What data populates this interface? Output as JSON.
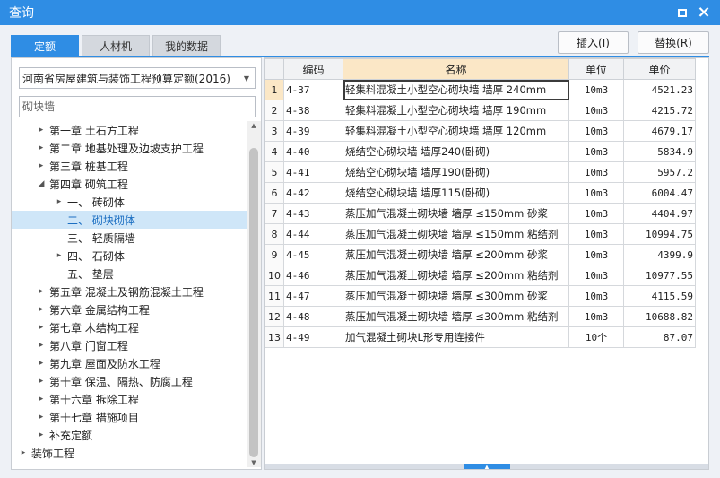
{
  "window": {
    "title": "查询"
  },
  "tabs": [
    {
      "label": "定额",
      "active": true
    },
    {
      "label": "人材机",
      "active": false
    },
    {
      "label": "我的数据",
      "active": false
    }
  ],
  "toolbar": {
    "insert_label": "插入(I)",
    "replace_label": "替换(R)"
  },
  "left": {
    "library": "河南省房屋建筑与装饰工程预算定额(2016)",
    "search_value": "",
    "search_placeholder": "砌块墙",
    "tree": [
      {
        "label": "第一章 土石方工程",
        "level": 1,
        "toggle": "▸",
        "selected": false
      },
      {
        "label": "第二章 地基处理及边坡支护工程",
        "level": 1,
        "toggle": "▸",
        "selected": false
      },
      {
        "label": "第三章 桩基工程",
        "level": 1,
        "toggle": "▸",
        "selected": false
      },
      {
        "label": "第四章 砌筑工程",
        "level": 1,
        "toggle": "◢",
        "selected": false
      },
      {
        "label": "一、  砖砌体",
        "level": 2,
        "toggle": "▸",
        "selected": false
      },
      {
        "label": "二、  砌块砌体",
        "level": 2,
        "toggle": "",
        "selected": true
      },
      {
        "label": "三、  轻质隔墙",
        "level": 2,
        "toggle": "",
        "selected": false
      },
      {
        "label": "四、  石砌体",
        "level": 2,
        "toggle": "▸",
        "selected": false
      },
      {
        "label": "五、  垫层",
        "level": 2,
        "toggle": "",
        "selected": false
      },
      {
        "label": "第五章 混凝土及钢筋混凝土工程",
        "level": 1,
        "toggle": "▸",
        "selected": false
      },
      {
        "label": "第六章 金属结构工程",
        "level": 1,
        "toggle": "▸",
        "selected": false
      },
      {
        "label": "第七章 木结构工程",
        "level": 1,
        "toggle": "▸",
        "selected": false
      },
      {
        "label": "第八章 门窗工程",
        "level": 1,
        "toggle": "▸",
        "selected": false
      },
      {
        "label": "第九章 屋面及防水工程",
        "level": 1,
        "toggle": "▸",
        "selected": false
      },
      {
        "label": "第十章 保温、隔热、防腐工程",
        "level": 1,
        "toggle": "▸",
        "selected": false
      },
      {
        "label": "第十六章 拆除工程",
        "level": 1,
        "toggle": "▸",
        "selected": false
      },
      {
        "label": "第十七章 措施项目",
        "level": 1,
        "toggle": "▸",
        "selected": false
      },
      {
        "label": "补充定额",
        "level": 1,
        "toggle": "▸",
        "selected": false
      },
      {
        "label": "装饰工程",
        "level": 0,
        "toggle": "▸",
        "selected": false
      }
    ]
  },
  "table": {
    "columns": [
      "",
      "编码",
      "名称",
      "单位",
      "单价"
    ],
    "highlight_column": "名称",
    "current_row": 1,
    "rows": [
      {
        "no": "1",
        "code": "4-37",
        "name": "轻集料混凝土小型空心砌块墙 墙厚 240mm",
        "unit": "10m3",
        "price": "4521.23"
      },
      {
        "no": "2",
        "code": "4-38",
        "name": "轻集料混凝土小型空心砌块墙 墙厚 190mm",
        "unit": "10m3",
        "price": "4215.72"
      },
      {
        "no": "3",
        "code": "4-39",
        "name": "轻集料混凝土小型空心砌块墙 墙厚 120mm",
        "unit": "10m3",
        "price": "4679.17"
      },
      {
        "no": "4",
        "code": "4-40",
        "name": "烧结空心砌块墙 墙厚240(卧砌)",
        "unit": "10m3",
        "price": "5834.9"
      },
      {
        "no": "5",
        "code": "4-41",
        "name": "烧结空心砌块墙 墙厚190(卧砌)",
        "unit": "10m3",
        "price": "5957.2"
      },
      {
        "no": "6",
        "code": "4-42",
        "name": "烧结空心砌块墙 墙厚115(卧砌)",
        "unit": "10m3",
        "price": "6004.47"
      },
      {
        "no": "7",
        "code": "4-43",
        "name": "蒸压加气混凝土砌块墙 墙厚 ≤150mm 砂浆",
        "unit": "10m3",
        "price": "4404.97"
      },
      {
        "no": "8",
        "code": "4-44",
        "name": "蒸压加气混凝土砌块墙 墙厚 ≤150mm 粘结剂",
        "unit": "10m3",
        "price": "10994.75"
      },
      {
        "no": "9",
        "code": "4-45",
        "name": "蒸压加气混凝土砌块墙 墙厚 ≤200mm 砂浆",
        "unit": "10m3",
        "price": "4399.9"
      },
      {
        "no": "10",
        "code": "4-46",
        "name": "蒸压加气混凝土砌块墙 墙厚 ≤200mm 粘结剂",
        "unit": "10m3",
        "price": "10977.55"
      },
      {
        "no": "11",
        "code": "4-47",
        "name": "蒸压加气混凝土砌块墙 墙厚 ≤300mm 砂浆",
        "unit": "10m3",
        "price": "4115.59"
      },
      {
        "no": "12",
        "code": "4-48",
        "name": "蒸压加气混凝土砌块墙 墙厚 ≤300mm 粘结剂",
        "unit": "10m3",
        "price": "10688.82"
      },
      {
        "no": "13",
        "code": "4-49",
        "name": "加气混凝土砌块L形专用连接件",
        "unit": "10个",
        "price": "87.07"
      }
    ]
  },
  "colors": {
    "accent": "#2f8de4",
    "header_highlight": "#fbe7c6",
    "selected_row": "#cfe6f8"
  }
}
